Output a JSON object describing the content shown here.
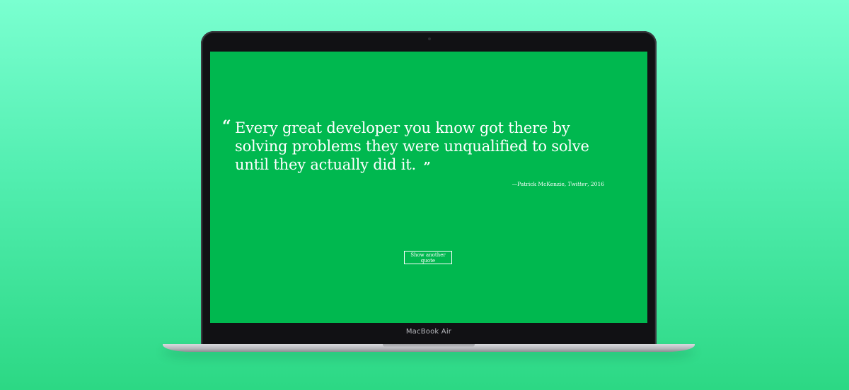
{
  "colors": {
    "background_top": "#7affd0",
    "background_bottom": "#2cd884",
    "screen": "#00b84f",
    "text": "#ffffff",
    "bezel": "#111114"
  },
  "device": {
    "label": "MacBook Air"
  },
  "quote": {
    "open_mark": "“",
    "text": "Every great developer you know got there by solving problems they were unqualified to solve until they actually did it.",
    "close_mark": "”",
    "attribution_prefix": "—Patrick McKenzie, ",
    "attribution_source": "Twitter",
    "attribution_suffix": ", 2016"
  },
  "actions": {
    "another_quote_label": "Show another quote"
  }
}
